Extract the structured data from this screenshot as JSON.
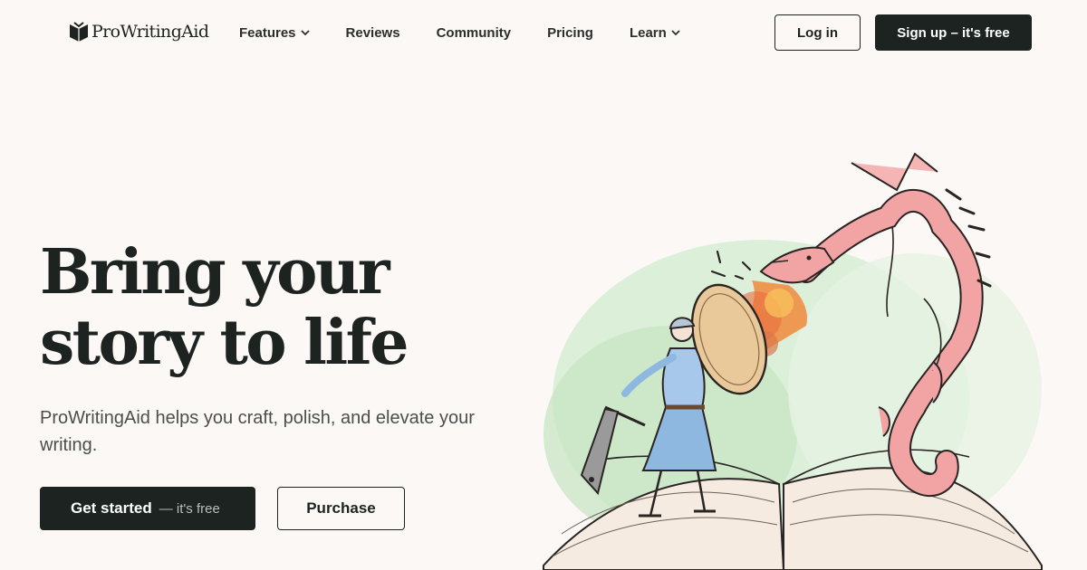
{
  "brand": {
    "name": "ProWritingAid",
    "logo_icon": "book-icon"
  },
  "nav": {
    "items": [
      {
        "label": "Features",
        "has_dropdown": true
      },
      {
        "label": "Reviews",
        "has_dropdown": false
      },
      {
        "label": "Community",
        "has_dropdown": false
      },
      {
        "label": "Pricing",
        "has_dropdown": false
      },
      {
        "label": "Learn",
        "has_dropdown": true
      }
    ],
    "login_label": "Log in",
    "signup_label": "Sign up – it's free"
  },
  "hero": {
    "title_line1": "Bring your",
    "title_line2": "story to life",
    "subtitle": "ProWritingAid helps you craft, polish, and elevate your writing.",
    "cta_primary_main": "Get started",
    "cta_primary_sub": "— it's free",
    "cta_secondary": "Purchase"
  },
  "colors": {
    "background": "#fcf8f6",
    "ink": "#1c2320",
    "dragon": "#f2a3a3",
    "fire": "#f08a3c",
    "knight_dress": "#8fb8e0",
    "wash": "#cfe9cf"
  }
}
